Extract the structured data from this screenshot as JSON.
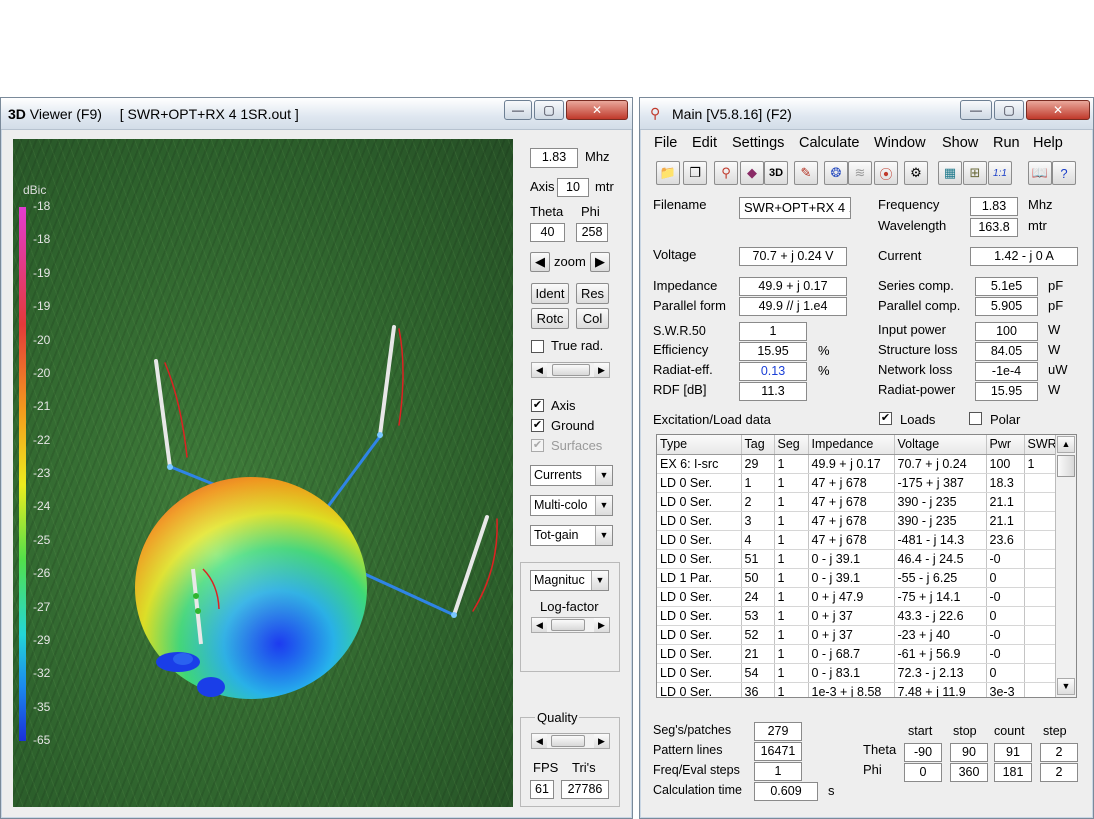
{
  "viewer": {
    "title_prefix": "3D",
    "title_name": "Viewer (F9)",
    "title_file": "[  SWR+OPT+RX 4 1SR.out ]",
    "legend": {
      "unit": "dBic",
      "ticks": [
        "-18",
        "-18",
        "-19",
        "-19",
        "-20",
        "-20",
        "-21",
        "-22",
        "-23",
        "-24",
        "-25",
        "-26",
        "-27",
        "-29",
        "-32",
        "-35",
        "-65"
      ]
    },
    "freq_value": "1.83",
    "freq_unit": "Mhz",
    "axis_label": "Axis",
    "axis_value": "10",
    "axis_unit": "mtr",
    "theta_label": "Theta",
    "phi_label": "Phi",
    "theta_value": "40",
    "phi_value": "258",
    "zoom_label": "zoom",
    "buttons": {
      "ident": "Ident",
      "res": "Res",
      "rotc": "Rotc",
      "col": "Col"
    },
    "true_rad_label": "True rad.",
    "checks": {
      "axis": "Axis",
      "ground": "Ground",
      "surfaces": "Surfaces"
    },
    "dropdowns": {
      "currents": "Currents",
      "multicolor": "Multi-colo",
      "totgain": "Tot-gain",
      "magnitude": "Magnituc"
    },
    "log_factor_label": "Log-factor",
    "quality_label": "Quality",
    "fps_label": "FPS",
    "tris_label": "Tri's",
    "fps_value": "61",
    "tris_value": "27786"
  },
  "main": {
    "title": "Main [V5.8.16]  (F2)",
    "menu": [
      "File",
      "Edit",
      "Settings",
      "Calculate",
      "Window",
      "Show",
      "Run",
      "Help"
    ],
    "filename_label": "Filename",
    "filename_value": "SWR+OPT+RX 4 1",
    "frequency_label": "Frequency",
    "frequency_value": "1.83",
    "frequency_unit": "Mhz",
    "wavelength_label": "Wavelength",
    "wavelength_value": "163.8",
    "wavelength_unit": "mtr",
    "voltage_label": "Voltage",
    "voltage_value": "70.7 + j 0.24 V",
    "current_label": "Current",
    "current_value": "1.42 - j 0 A",
    "impedance_label": "Impedance",
    "impedance_value": "49.9 + j 0.17",
    "parallel_form_label": "Parallel form",
    "parallel_form_value": "49.9 // j 1.e4",
    "series_comp_label": "Series comp.",
    "series_comp_value": "5.1e5",
    "series_comp_unit": "pF",
    "parallel_comp_label": "Parallel comp.",
    "parallel_comp_value": "5.905",
    "parallel_comp_unit": "pF",
    "swr_label": "S.W.R.50",
    "swr_value": "1",
    "efficiency_label": "Efficiency",
    "efficiency_value": "15.95",
    "efficiency_unit": "%",
    "radiat_eff_label": "Radiat-eff.",
    "radiat_eff_value": "0.13",
    "radiat_eff_unit": "%",
    "rdf_label": "RDF [dB]",
    "rdf_value": "11.3",
    "input_power_label": "Input power",
    "input_power_value": "100",
    "input_power_unit": "W",
    "structure_loss_label": "Structure loss",
    "structure_loss_value": "84.05",
    "structure_loss_unit": "W",
    "network_loss_label": "Network loss",
    "network_loss_value": "-1e-4",
    "network_loss_unit": "uW",
    "radiat_power_label": "Radiat-power",
    "radiat_power_value": "15.95",
    "radiat_power_unit": "W",
    "excitation_label": "Excitation/Load data",
    "loads_label": "Loads",
    "polar_label": "Polar",
    "table": {
      "headers": [
        "Type",
        "Tag",
        "Seg",
        "Impedance",
        "Voltage",
        "Pwr",
        "SWR"
      ],
      "rows": [
        [
          "EX 6: I-src",
          "29",
          "1",
          "49.9 + j 0.17",
          "70.7 + j 0.24",
          "100",
          "1"
        ],
        [
          "LD 0 Ser.",
          "1",
          "1",
          "47 + j 678",
          "-175 + j 387",
          "18.3",
          ""
        ],
        [
          "LD 0 Ser.",
          "2",
          "1",
          "47 + j 678",
          "390 - j 235",
          "21.1",
          ""
        ],
        [
          "LD 0 Ser.",
          "3",
          "1",
          "47 + j 678",
          "390 - j 235",
          "21.1",
          ""
        ],
        [
          "LD 0 Ser.",
          "4",
          "1",
          "47 + j 678",
          "-481 - j 14.3",
          "23.6",
          ""
        ],
        [
          "LD 0 Ser.",
          "51",
          "1",
          "0 - j 39.1",
          "46.4 - j 24.5",
          "-0",
          ""
        ],
        [
          "LD 1 Par.",
          "50",
          "1",
          "0 - j 39.1",
          "-55 - j 6.25",
          "0",
          ""
        ],
        [
          "LD 0 Ser.",
          "24",
          "1",
          "0 + j 47.9",
          "-75 + j 14.1",
          "-0",
          ""
        ],
        [
          "LD 0 Ser.",
          "53",
          "1",
          "0 + j 37",
          "43.3 - j 22.6",
          "0",
          ""
        ],
        [
          "LD 0 Ser.",
          "52",
          "1",
          "0 + j 37",
          "-23 + j 40",
          "-0",
          ""
        ],
        [
          "LD 0 Ser.",
          "21",
          "1",
          "0 - j 68.7",
          "-61 + j 56.9",
          "-0",
          ""
        ],
        [
          "LD 0 Ser.",
          "54",
          "1",
          "0 - j 83.1",
          "72.3 - j 2.13",
          "0",
          ""
        ],
        [
          "LD 0 Ser.",
          "36",
          "1",
          "1e-3 + j 8.58",
          "7.48 + j 11.9",
          "3e-3",
          ""
        ]
      ]
    },
    "segs_label": "Seg's/patches",
    "segs_value": "279",
    "pattern_lines_label": "Pattern lines",
    "pattern_lines_value": "16471",
    "freq_eval_label": "Freq/Eval steps",
    "freq_eval_value": "1",
    "calc_time_label": "Calculation time",
    "calc_time_value": "0.609",
    "calc_time_unit": "s",
    "pattern": {
      "col_start": "start",
      "col_stop": "stop",
      "col_count": "count",
      "col_step": "step",
      "theta_label": "Theta",
      "theta": [
        "-90",
        "90",
        "91",
        "2"
      ],
      "phi_label": "Phi",
      "phi": [
        "0",
        "360",
        "181",
        "2"
      ]
    }
  },
  "colors": {
    "accent_blue": "#1a3fd6",
    "ground_green": "#2f6a2f",
    "legend_top": "#e23bd0",
    "legend_bottom": "#1a2fd9"
  }
}
